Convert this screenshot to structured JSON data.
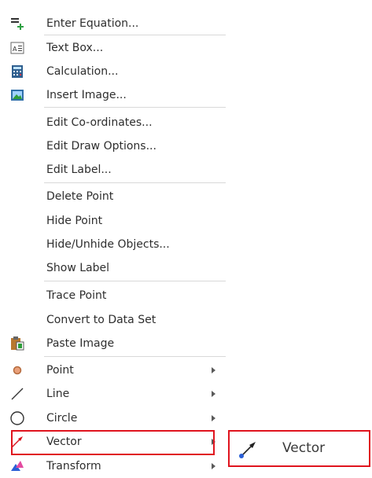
{
  "menu": {
    "items": [
      {
        "label": "Enter Equation...",
        "icon": "equation-icon"
      },
      {
        "label": "Text Box...",
        "icon": "text-box-icon"
      },
      {
        "label": "Calculation...",
        "icon": "calculator-icon"
      },
      {
        "label": "Insert Image...",
        "icon": "image-icon"
      },
      {
        "label": "Edit Co-ordinates..."
      },
      {
        "label": "Edit Draw Options..."
      },
      {
        "label": "Edit Label..."
      },
      {
        "label": "Delete Point"
      },
      {
        "label": "Hide Point"
      },
      {
        "label": "Hide/Unhide Objects..."
      },
      {
        "label": "Show Label"
      },
      {
        "label": "Trace Point"
      },
      {
        "label": "Convert to Data Set"
      },
      {
        "label": "Paste Image",
        "icon": "clipboard-icon"
      },
      {
        "label": "Point",
        "icon": "point-icon"
      },
      {
        "label": "Line",
        "icon": "line-icon"
      },
      {
        "label": "Circle",
        "icon": "circle-icon"
      },
      {
        "label": "Vector",
        "icon": "vector-icon"
      },
      {
        "label": "Transform",
        "icon": "transform-icon"
      }
    ]
  },
  "submenu": {
    "label": "Vector",
    "icon": "vector-icon"
  },
  "colors": {
    "highlight_border": "#e0141e",
    "separator": "#d9d9d9",
    "vector_red": "#d9141e",
    "vector_blue": "#2a5fd6"
  }
}
